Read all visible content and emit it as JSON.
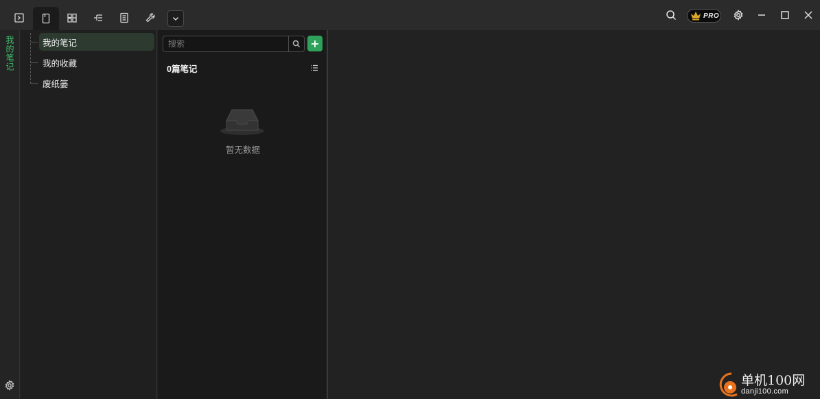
{
  "toolbar": {
    "tabs": [
      {
        "icon": "terminal-icon"
      },
      {
        "icon": "notebook-icon",
        "active": true
      },
      {
        "icon": "layout-icon"
      },
      {
        "icon": "tree-icon"
      },
      {
        "icon": "document-list-icon"
      },
      {
        "icon": "wrench-icon"
      }
    ],
    "dropdown_icon": "chevron-down-icon",
    "pro_badge": "PRO"
  },
  "rail": {
    "label": "我的笔记"
  },
  "tree": {
    "items": [
      {
        "label": "我的笔记",
        "active": true
      },
      {
        "label": "我的收藏",
        "active": false
      },
      {
        "label": "废纸篓",
        "active": false
      }
    ]
  },
  "notes": {
    "search_placeholder": "搜索",
    "count_label": "0篇笔记",
    "empty_text": "暂无数据"
  },
  "watermark": {
    "main": "单机100网",
    "sub": "danji100.com"
  },
  "colors": {
    "accent": "#2ea25a",
    "rail_label": "#3fbf6b",
    "background": "#222222"
  }
}
